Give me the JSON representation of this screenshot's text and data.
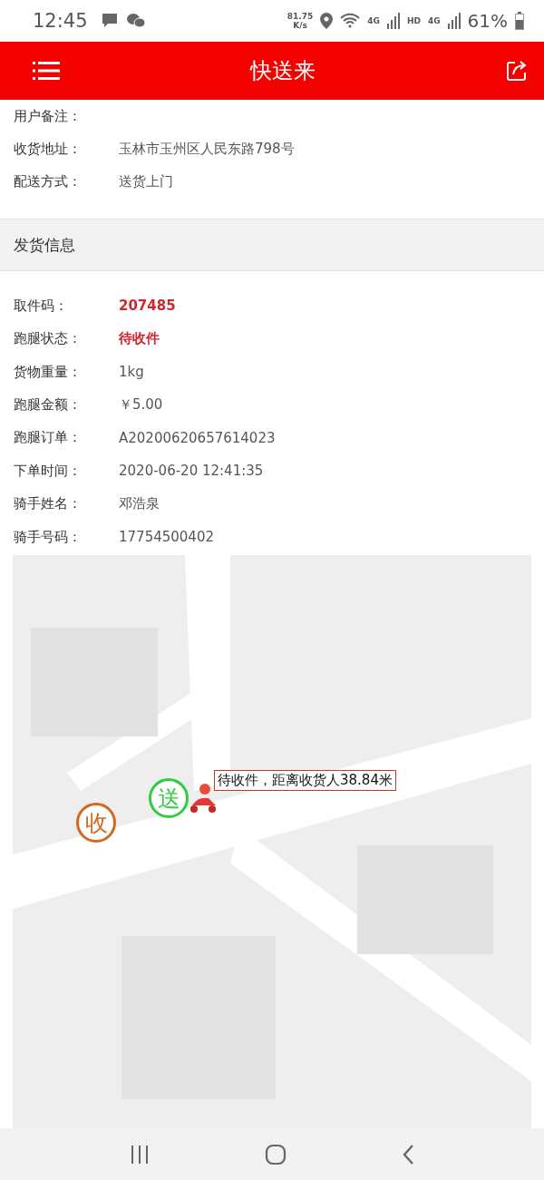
{
  "status_bar": {
    "time": "12:45",
    "speed_value": "81.75",
    "speed_unit": "K/s",
    "network_1": "4G",
    "hd": "HD",
    "network_2": "4G",
    "battery": "61%"
  },
  "header": {
    "title": "快送来"
  },
  "receiver_rows": [
    {
      "label": "用户备注：",
      "value": ""
    },
    {
      "label": "收货地址：",
      "value": "玉林市玉州区人民东路798号"
    },
    {
      "label": "配送方式：",
      "value": "送货上门"
    }
  ],
  "section": {
    "title": "发货信息"
  },
  "shipping_rows": [
    {
      "label": "取件码：",
      "value": "207485",
      "highlight": true
    },
    {
      "label": "跑腿状态：",
      "value": "待收件",
      "highlight": true
    },
    {
      "label": "货物重量：",
      "value": "1kg",
      "highlight": false
    },
    {
      "label": "跑腿金额：",
      "value": "￥5.00",
      "highlight": false
    },
    {
      "label": "跑腿订单：",
      "value": "A20200620657614023",
      "highlight": false
    },
    {
      "label": "下单时间：",
      "value": "2020-06-20 12:41:35",
      "highlight": false
    },
    {
      "label": "骑手姓名：",
      "value": "邓浩泉",
      "highlight": false
    },
    {
      "label": "骑手号码：",
      "value": "17754500402",
      "highlight": false
    }
  ],
  "map": {
    "receiver_marker": "收",
    "sender_marker": "送",
    "rider_label": "待收件，距离收货人38.84米"
  }
}
